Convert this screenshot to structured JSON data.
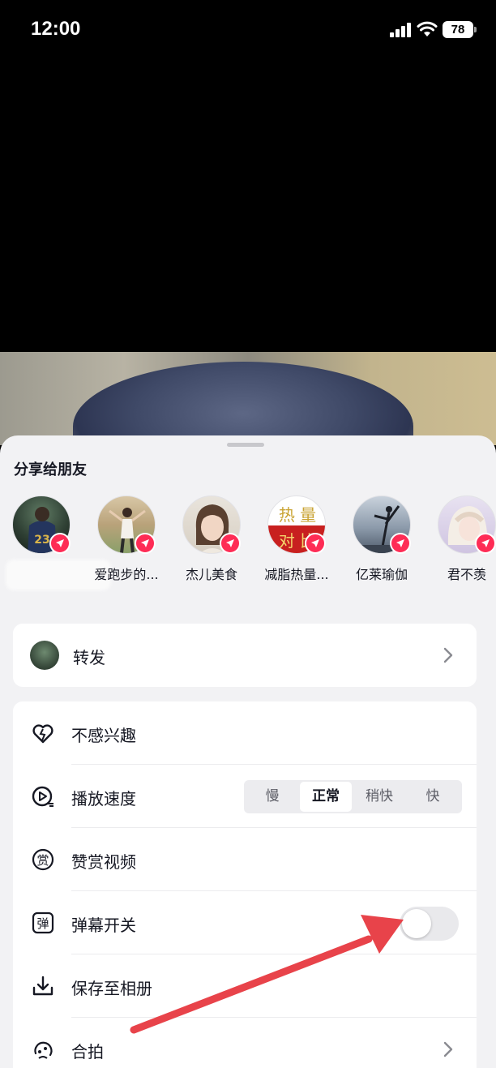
{
  "status_bar": {
    "time": "12:00",
    "battery": "78",
    "icons": [
      "signal-icon",
      "wifi-icon",
      "battery-icon"
    ]
  },
  "share_sheet": {
    "title": "分享给朋友",
    "friends": [
      {
        "name": "",
        "avatar": "basketball-jersey-avatar"
      },
      {
        "name": "爱跑步的...",
        "avatar": "dancer-avatar"
      },
      {
        "name": "杰儿美食",
        "avatar": "girl-portrait-avatar"
      },
      {
        "name": "减脂热量...",
        "avatar": "red-text-avatar",
        "avatar_text_top": "热 量",
        "avatar_text_bottom": "对 比"
      },
      {
        "name": "亿莱瑜伽",
        "avatar": "yoga-silhouette-avatar"
      },
      {
        "name": "君不羡",
        "avatar": "anime-avatar"
      }
    ],
    "forward": {
      "label": "转发"
    },
    "options": [
      {
        "label": "不感兴趣",
        "icon": "heart-outline-icon"
      },
      {
        "label": "播放速度",
        "icon": "speed-play-icon"
      },
      {
        "label": "赞赏视频",
        "icon": "reward-icon",
        "icon_text": "赏"
      },
      {
        "label": "弹幕开关",
        "icon": "danmaku-icon",
        "icon_text": "弹"
      },
      {
        "label": "保存至相册",
        "icon": "download-icon"
      },
      {
        "label": "合拍",
        "icon": "duet-icon"
      }
    ],
    "speed_options": [
      "慢",
      "正常",
      "稍快",
      "快"
    ],
    "speed_selected": "正常",
    "danmaku_enabled": false
  },
  "colors": {
    "accent": "#fe2c55",
    "annotation_arrow": "#e8434a"
  }
}
